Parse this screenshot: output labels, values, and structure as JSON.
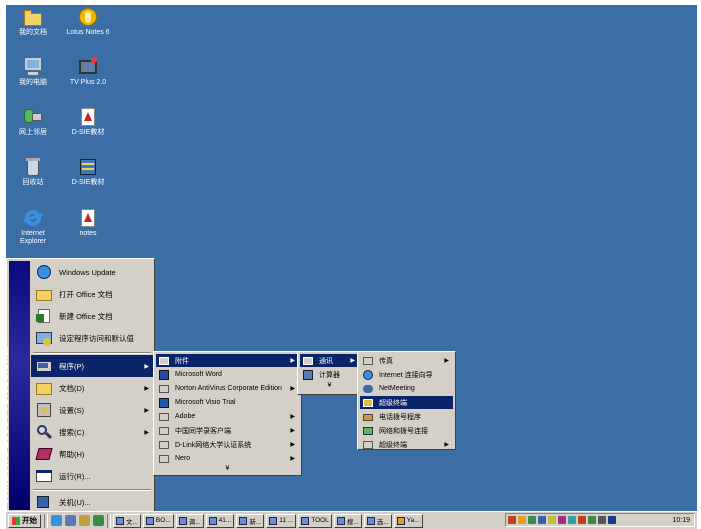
{
  "desktop": {
    "icons": [
      {
        "label": "我的文档",
        "icon": "folder-icon",
        "color": "#f2d266"
      },
      {
        "label": "Lotus Notes 6",
        "icon": "lotus-notes-icon",
        "color": "#f5b400"
      },
      {
        "label": "我的电脑",
        "icon": "computer-icon",
        "color": "#7fb2e0"
      },
      {
        "label": "TV Plus 2.0",
        "icon": "tv-icon",
        "color": "#607fa8"
      },
      {
        "label": "网上邻居",
        "icon": "network-icon",
        "color": "#5cb85c"
      },
      {
        "label": "D-SIE教材",
        "icon": "pdf-icon",
        "color": "#cc2222"
      },
      {
        "label": "回收站",
        "icon": "recycle-bin-icon",
        "color": "#c8d8e8"
      },
      {
        "label": "D-SIE教材",
        "icon": "book-icon",
        "color": "#3c78b4"
      },
      {
        "label": "Internet Explorer",
        "icon": "ie-icon",
        "color": "#3a90e0"
      },
      {
        "label": "notes",
        "icon": "pdf-icon",
        "color": "#cc2222"
      }
    ]
  },
  "start_menu": {
    "banner": "Windows 2000 Professional",
    "top_items": [
      {
        "label": "Windows Update",
        "icon": "globe-icon"
      },
      {
        "label": "打开 Office 文档",
        "icon": "open-folder-icon"
      },
      {
        "label": "新建 Office 文档",
        "icon": "new-document-icon"
      },
      {
        "label": "设定程序访问和默认值",
        "icon": "program-defaults-icon"
      }
    ],
    "main_items": [
      {
        "label": "程序(P)",
        "icon": "programs-icon",
        "highlighted": true,
        "submenu": true
      },
      {
        "label": "文档(D)",
        "icon": "documents-icon",
        "submenu": true
      },
      {
        "label": "设置(S)",
        "icon": "settings-icon",
        "submenu": true
      },
      {
        "label": "搜索(C)",
        "icon": "search-icon",
        "submenu": true
      },
      {
        "label": "帮助(H)",
        "icon": "help-icon",
        "submenu": false
      },
      {
        "label": "运行(R)...",
        "icon": "run-icon",
        "submenu": false
      },
      {
        "label": "关机(U)...",
        "icon": "shutdown-icon",
        "submenu": false
      }
    ]
  },
  "programs_menu": {
    "items": [
      {
        "label": "附件",
        "highlighted": true,
        "submenu": true
      },
      {
        "label": "Microsoft Word",
        "submenu": false
      },
      {
        "label": "Norton AntiVirus Corporate Edition",
        "submenu": true
      },
      {
        "label": "Microsoft Visio Trial",
        "submenu": false
      },
      {
        "label": "Adobe",
        "submenu": true
      },
      {
        "label": "中国同学录客户端",
        "submenu": true
      },
      {
        "label": "D-Link网络大学认证系统",
        "submenu": true
      },
      {
        "label": "Nero",
        "submenu": true
      }
    ],
    "more": "¥"
  },
  "accessories_menu": {
    "items": [
      {
        "label": "通讯",
        "highlighted": true,
        "submenu": true
      },
      {
        "label": "计算器",
        "submenu": false
      }
    ],
    "more": "¥"
  },
  "communications_menu": {
    "items": [
      {
        "label": "传真",
        "submenu": true
      },
      {
        "label": "Internet 连接向导",
        "submenu": false
      },
      {
        "label": "NetMeeting",
        "submenu": false
      },
      {
        "label": "超级终端",
        "highlighted": true,
        "submenu": false
      },
      {
        "label": "电话拨号程序",
        "submenu": false
      },
      {
        "label": "网络和拨号连接",
        "submenu": false
      },
      {
        "label": "超级终端",
        "submenu": true
      }
    ]
  },
  "taskbar": {
    "start_label": "开始",
    "buttons": [
      "文...",
      "BO...",
      "调...",
      "41...",
      "新...",
      "11 ...",
      "TOOL",
      "搜...",
      "选...",
      "Ya..."
    ],
    "clock": "10:19"
  }
}
